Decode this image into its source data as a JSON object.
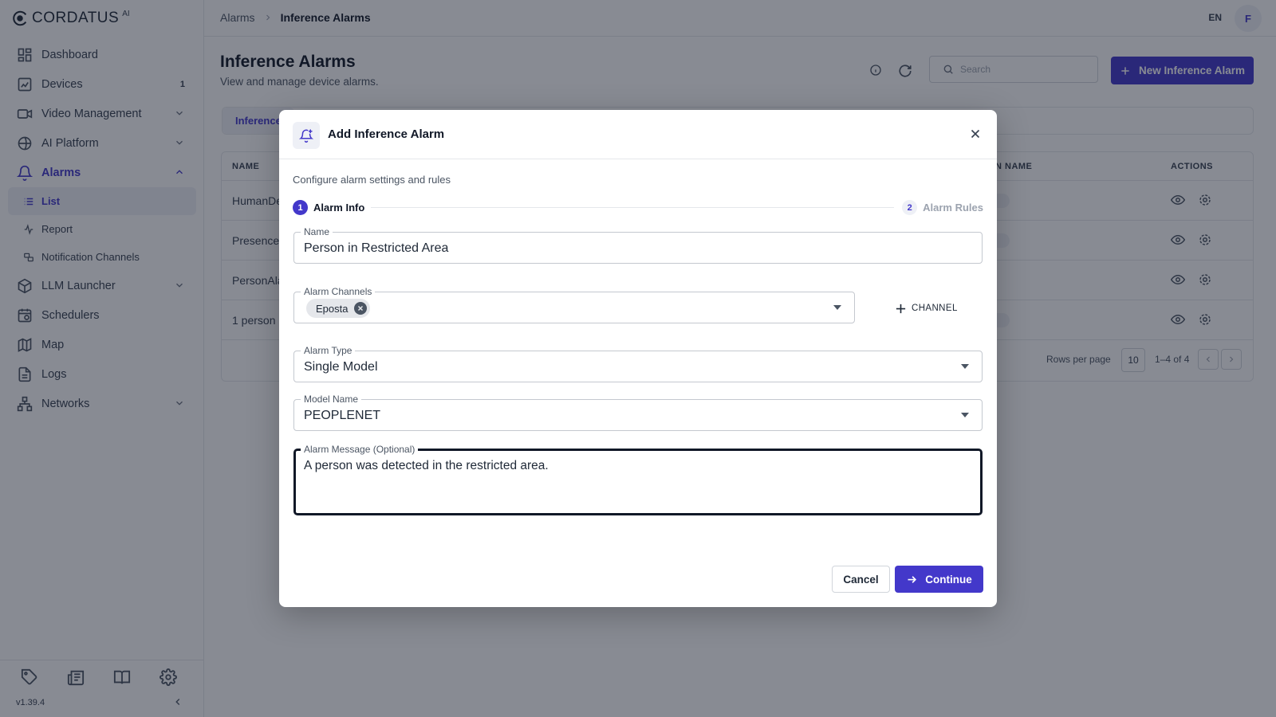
{
  "brand": {
    "name": "CORDATUS",
    "suffix": "AI"
  },
  "sidebar": {
    "items": [
      {
        "label": "Dashboard",
        "icon": "dashboard-icon"
      },
      {
        "label": "Devices",
        "icon": "devices-icon",
        "badge": "1"
      },
      {
        "label": "Video Management",
        "icon": "video-icon",
        "chevron": "chevron-down-icon"
      },
      {
        "label": "AI Platform",
        "icon": "ai-platform-icon",
        "chevron": "chevron-down-icon"
      },
      {
        "label": "Alarms",
        "icon": "bell-icon",
        "chevron": "chevron-up-icon",
        "active": true
      },
      {
        "label": "LLM Launcher",
        "icon": "llm-icon",
        "chevron": "chevron-down-icon"
      },
      {
        "label": "Schedulers",
        "icon": "calendar-clock-icon"
      },
      {
        "label": "Map",
        "icon": "map-icon"
      },
      {
        "label": "Logs",
        "icon": "file-text-icon"
      },
      {
        "label": "Networks",
        "icon": "network-icon",
        "chevron": "chevron-down-icon"
      }
    ],
    "alarm_sub_items": [
      {
        "label": "List",
        "icon": "list-icon",
        "selected": true
      },
      {
        "label": "Report",
        "icon": "activity-icon"
      },
      {
        "label": "Notification Channels",
        "icon": "channels-icon"
      }
    ],
    "footer_icons": [
      "tag-icon",
      "newspaper-icon",
      "book-open-icon",
      "gear-icon"
    ],
    "version": "v1.39.4"
  },
  "topbar": {
    "breadcrumb_parent": "Alarms",
    "breadcrumb_current": "Inference Alarms",
    "language": "EN",
    "avatar_initial": "F"
  },
  "page": {
    "title": "Inference Alarms",
    "subtitle": "View and manage device alarms.",
    "search_placeholder": "Search",
    "new_button": "New Inference Alarm",
    "active_tab": "Inference"
  },
  "table": {
    "headers": {
      "name": "NAME",
      "channel_name": "N NAME",
      "actions": "ACTIONS"
    },
    "rows": [
      "HumanDe",
      "Presence",
      "PersonAla",
      "1 person"
    ],
    "rows_per_page_label": "Rows per page",
    "rows_per_page": "10",
    "range": "1–4 of 4"
  },
  "dialog": {
    "title": "Add Inference Alarm",
    "description": "Configure alarm settings and rules",
    "steps": [
      {
        "number": "1",
        "label": "Alarm Info",
        "active": true
      },
      {
        "number": "2",
        "label": "Alarm Rules",
        "active": false
      }
    ],
    "fields": {
      "name": {
        "label": "Name",
        "value": "Person in Restricted Area"
      },
      "channels": {
        "label": "Alarm Channels",
        "chips": [
          "Eposta"
        ]
      },
      "add_channel": "CHANNEL",
      "alarm_type": {
        "label": "Alarm Type",
        "value": "Single Model"
      },
      "model_name": {
        "label": "Model Name",
        "value": "PEOPLENET"
      },
      "message": {
        "label": "Alarm Message (Optional)",
        "value": "A person was detected in the restricted area."
      }
    },
    "cancel": "Cancel",
    "continue": "Continue"
  },
  "colors": {
    "accent": "#4338ca",
    "accent_soft": "#eef0f6",
    "overlay": "rgba(17,24,39,0.5)"
  }
}
